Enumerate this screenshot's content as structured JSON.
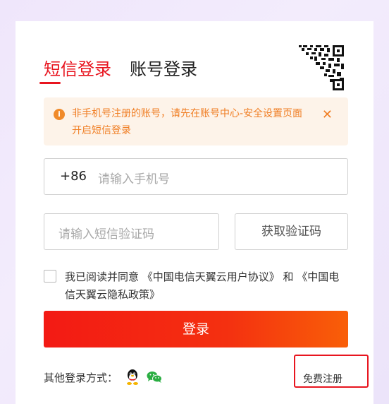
{
  "tabs": [
    {
      "label": "短信登录",
      "active": true
    },
    {
      "label": "账号登录",
      "active": false
    }
  ],
  "notice": {
    "text": "非手机号注册的账号，请先在账号中心-安全设置页面开启短信登录",
    "close": "✕"
  },
  "phone": {
    "prefix": "+86",
    "placeholder": "请输入手机号"
  },
  "code": {
    "placeholder": "请输入短信验证码",
    "button_label": "获取验证码"
  },
  "agreement": {
    "text": "我已阅读并同意 《中国电信天翼云用户协议》 和 《中国电信天翼云隐私政策》",
    "checked": false
  },
  "login_button": "登录",
  "other_login": {
    "label": "其他登录方式：",
    "icons": [
      "qq-icon",
      "wechat-icon"
    ]
  },
  "register": "免费注册",
  "colors": {
    "accent": "#e8151f",
    "notice_text": "#f07e24",
    "notice_bg": "#fdf3e9"
  }
}
